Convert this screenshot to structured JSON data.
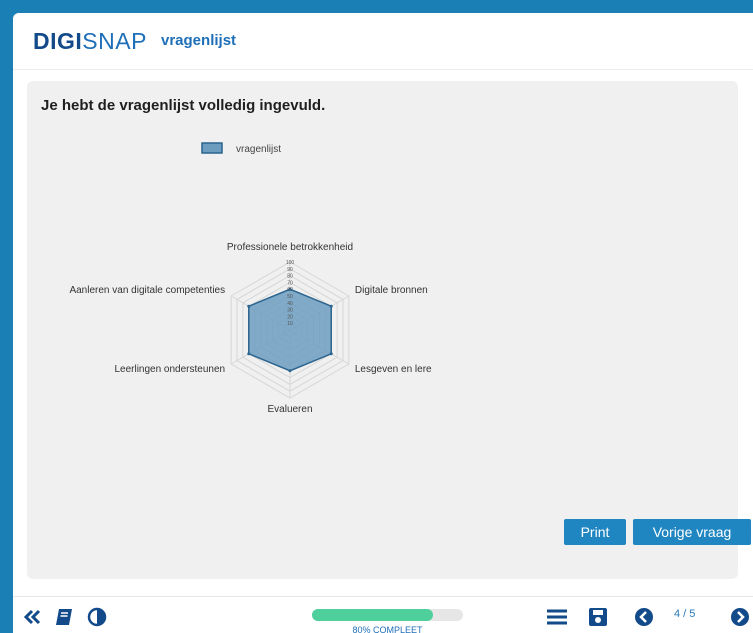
{
  "header": {
    "logo_bold": "DIGI",
    "logo_light": "SNAP",
    "subtitle": "vragenlijst"
  },
  "main": {
    "title": "Je hebt de vragenlijst volledig ingevuld."
  },
  "chart_data": {
    "type": "radar",
    "legend": [
      "vragenlijst"
    ],
    "axes": [
      "Professionele betrokkenheid",
      "Digitale bronnen",
      "Lesgeven en lere",
      "Evalueren",
      "Leerlingen ondersteunen",
      "Aanleren van digitale competenties"
    ],
    "tick_labels": [
      "0",
      "10",
      "20",
      "30",
      "40",
      "50",
      "60",
      "70",
      "80",
      "90",
      "100"
    ],
    "range": [
      0,
      100
    ],
    "series": [
      {
        "name": "vragenlijst",
        "values": [
          60,
          70,
          70,
          60,
          70,
          70
        ]
      }
    ],
    "colors": {
      "fill": "#6c9dbf",
      "stroke": "#2b648f",
      "grid": "#d6d6d6"
    }
  },
  "buttons": {
    "print": "Print",
    "previous": "Vorige vraag"
  },
  "footer": {
    "progress_percent": 80,
    "progress_label": "80% COMPLEET",
    "page_indicator": "4 / 5"
  },
  "icons": {
    "collapse": "double-chevron-left-icon",
    "book": "book-icon",
    "contrast": "contrast-icon",
    "menu": "hamburger-menu-icon",
    "save": "save-icon",
    "prev": "circle-chevron-left-icon",
    "next": "circle-chevron-right-icon"
  }
}
